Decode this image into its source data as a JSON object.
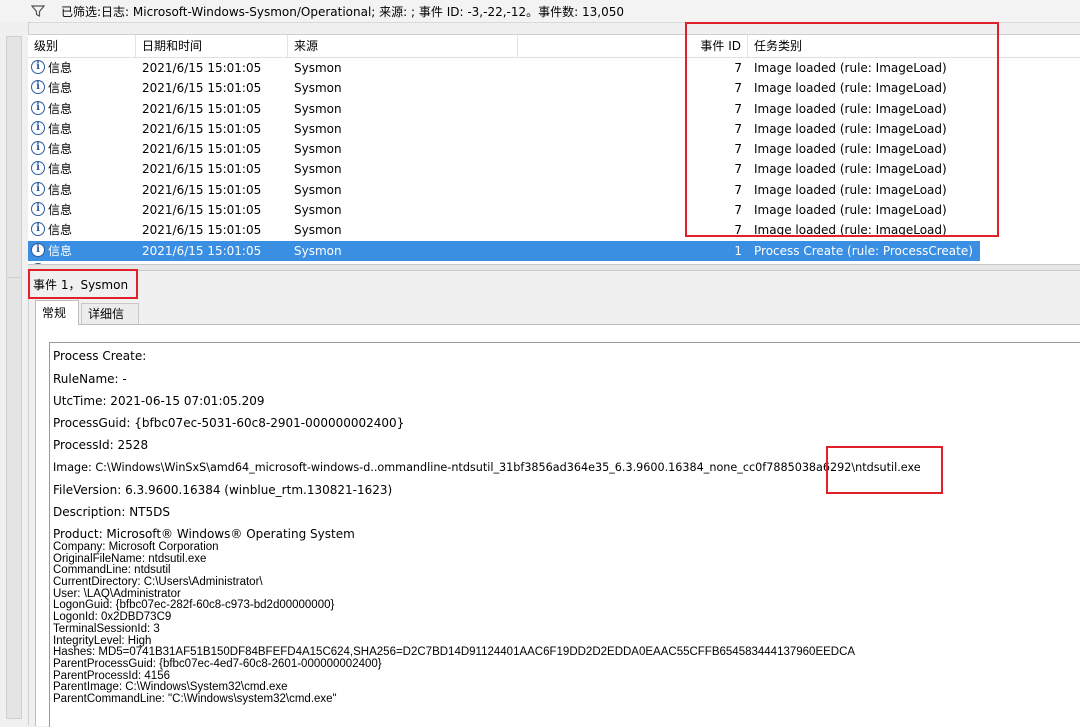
{
  "filter_bar": {
    "text": "已筛选:日志: Microsoft-Windows-Sysmon/Operational; 来源: ; 事件 ID: -3,-22,-12。事件数: 13,050"
  },
  "columns": {
    "level": "级别",
    "datetime": "日期和时间",
    "source": "来源",
    "event_id": "事件 ID",
    "task_category": "任务类别"
  },
  "rows": [
    {
      "level": "信息",
      "datetime": "2021/6/15 15:01:05",
      "source": "Sysmon",
      "event_id": "7",
      "task": "Image loaded (rule: ImageLoad)"
    },
    {
      "level": "信息",
      "datetime": "2021/6/15 15:01:05",
      "source": "Sysmon",
      "event_id": "7",
      "task": "Image loaded (rule: ImageLoad)"
    },
    {
      "level": "信息",
      "datetime": "2021/6/15 15:01:05",
      "source": "Sysmon",
      "event_id": "7",
      "task": "Image loaded (rule: ImageLoad)"
    },
    {
      "level": "信息",
      "datetime": "2021/6/15 15:01:05",
      "source": "Sysmon",
      "event_id": "7",
      "task": "Image loaded (rule: ImageLoad)"
    },
    {
      "level": "信息",
      "datetime": "2021/6/15 15:01:05",
      "source": "Sysmon",
      "event_id": "7",
      "task": "Image loaded (rule: ImageLoad)"
    },
    {
      "level": "信息",
      "datetime": "2021/6/15 15:01:05",
      "source": "Sysmon",
      "event_id": "7",
      "task": "Image loaded (rule: ImageLoad)"
    },
    {
      "level": "信息",
      "datetime": "2021/6/15 15:01:05",
      "source": "Sysmon",
      "event_id": "7",
      "task": "Image loaded (rule: ImageLoad)"
    },
    {
      "level": "信息",
      "datetime": "2021/6/15 15:01:05",
      "source": "Sysmon",
      "event_id": "7",
      "task": "Image loaded (rule: ImageLoad)"
    },
    {
      "level": "信息",
      "datetime": "2021/6/15 15:01:05",
      "source": "Sysmon",
      "event_id": "7",
      "task": "Image loaded (rule: ImageLoad)"
    },
    {
      "level": "信息",
      "datetime": "2021/6/15 15:01:05",
      "source": "Sysmon",
      "event_id": "1",
      "task": "Process Create (rule: ProcessCreate)",
      "selected": true
    }
  ],
  "detail": {
    "title": "事件 1，Sysmon",
    "tabs": [
      "常规",
      "详细信息"
    ],
    "fields": [
      "Process Create:",
      "RuleName: -",
      "UtcTime: 2021-06-15 07:01:05.209",
      "ProcessGuid: {bfbc07ec-5031-60c8-2901-000000002400}",
      "ProcessId: 2528",
      "Image: C:\\Windows\\WinSxS\\amd64_microsoft-windows-d..ommandline-ntdsutil_31bf3856ad364e35_6.3.9600.16384_none_cc0f7885038a6292\\ntdsutil.exe",
      "FileVersion: 6.3.9600.16384 (winblue_rtm.130821-1623)",
      "Description: NT5DS",
      "Product: Microsoft® Windows® Operating System"
    ],
    "dense_lines": [
      "Company: Microsoft Corporation",
      "OriginalFileName: ntdsutil.exe",
      "CommandLine: ntdsutil",
      "CurrentDirectory: C:\\Users\\Administrator\\",
      "User: \\LAQ\\Administrator",
      "LogonGuid: {bfbc07ec-282f-60c8-c973-bd2d00000000}",
      "LogonId: 0x2DBD73C9",
      "TerminalSessionId: 3",
      "IntegrityLevel: High",
      "Hashes: MD5=0741B31AF51B150DF84BFEFD4A15C624,SHA256=D2C7BD14D91124401AAC6F19DD2D2EDDA0EAAC55CFFB654583444137960EEDCA",
      "ParentProcessGuid: {bfbc07ec-4ed7-60c8-2601-000000002400}",
      "ParentProcessId: 4156",
      "ParentImage: C:\\Windows\\System32\\cmd.exe",
      "ParentCommandLine: \"C:\\Windows\\system32\\cmd.exe\""
    ]
  },
  "colors": {
    "highlight_box": "#e0202a",
    "selection": "#3b8fe3",
    "info_icon": "#2c5a9e"
  }
}
